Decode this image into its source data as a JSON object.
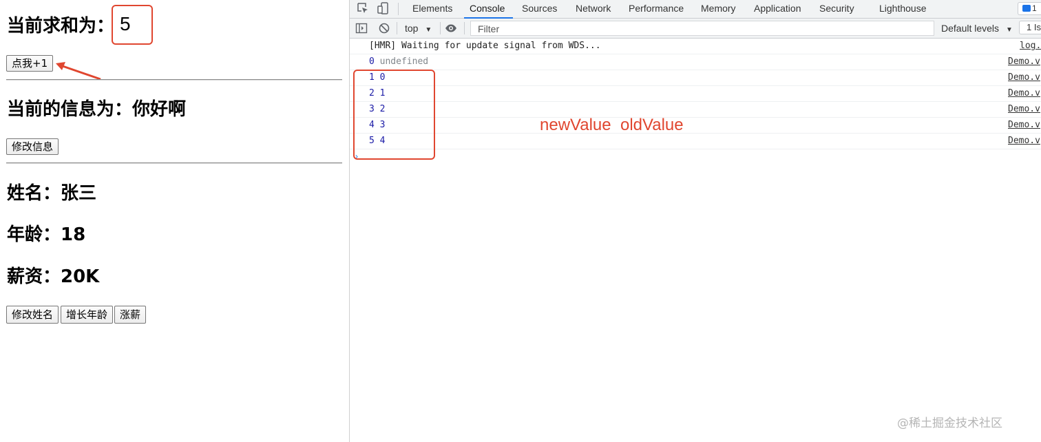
{
  "app": {
    "sum_label": "当前求和为：",
    "sum_value": "5",
    "increment_button": "点我+1",
    "msg_label": "当前的信息为：你好啊",
    "edit_msg_button": "修改信息",
    "name_line": "姓名：张三",
    "age_line": "年龄：18",
    "salary_line": "薪资：20K",
    "buttons": {
      "edit_name": "修改姓名",
      "grow_age": "增长年龄",
      "raise": "涨薪"
    }
  },
  "devtools": {
    "tabs": [
      "Elements",
      "Console",
      "Sources",
      "Network",
      "Performance",
      "Memory",
      "Application",
      "Security",
      "Lighthouse"
    ],
    "active_tab": "Console",
    "message_badge": "1",
    "context": "top",
    "filter_placeholder": "Filter",
    "levels": "Default levels",
    "issues": "1 Is"
  },
  "console": {
    "rows": [
      {
        "text": "[HMR] Waiting for update signal from WDS...",
        "source": "log.j"
      },
      {
        "a": "0",
        "b": "undefined",
        "source": "Demo.v"
      },
      {
        "a": "1",
        "b": "0",
        "source": "Demo.v"
      },
      {
        "a": "2",
        "b": "1",
        "source": "Demo.v"
      },
      {
        "a": "3",
        "b": "2",
        "source": "Demo.v"
      },
      {
        "a": "4",
        "b": "3",
        "source": "Demo.v"
      },
      {
        "a": "5",
        "b": "4",
        "source": "Demo.v"
      }
    ],
    "annotation": "newValue  oldValue"
  },
  "watermark": "@稀土掘金技术社区",
  "colors": {
    "annotation_red": "#e0462f",
    "devtools_blue": "#1a73e8",
    "number_blue": "#1a1aa6"
  }
}
